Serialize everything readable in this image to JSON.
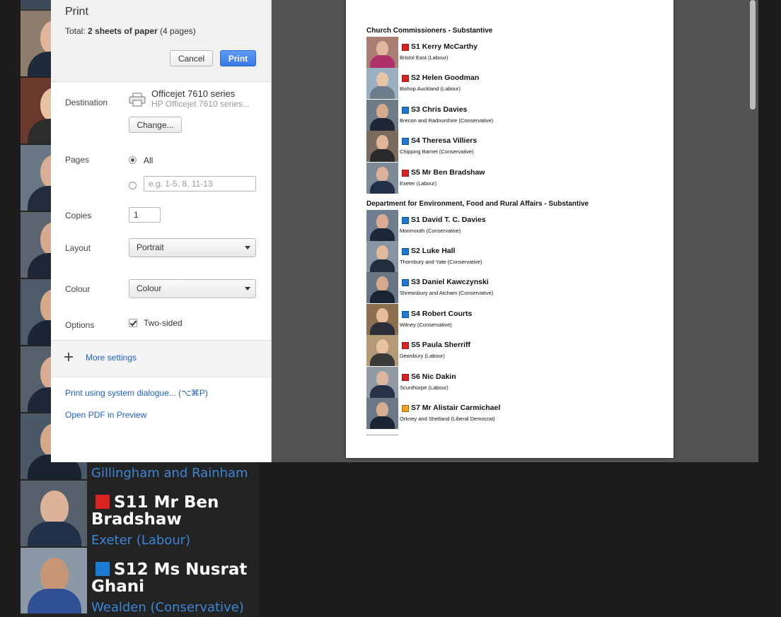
{
  "background": {
    "visible_cards": [
      {
        "constituency": "Gillingham and Rainham"
      },
      {
        "position": "S11",
        "name": "Mr Ben Bradshaw",
        "constituency": "Exeter (Labour)",
        "party_color": "#d92323"
      },
      {
        "position": "S12",
        "name": "Ms Nusrat Ghani",
        "constituency": "Wealden (Conservative)",
        "party_color": "#1a7ad4"
      }
    ]
  },
  "dialog": {
    "title": "Print",
    "total_prefix": "Total: ",
    "total_sheets": "2 sheets of paper",
    "total_pages": " (4 pages)",
    "cancel_label": "Cancel",
    "print_label": "Print",
    "destination": {
      "label": "Destination",
      "printer_name": "Officejet 7610 series",
      "printer_model": "HP Officejet 7610 series...",
      "change_label": "Change...",
      "icon": "printer-icon"
    },
    "pages": {
      "label": "Pages",
      "all_label": "All",
      "all_selected": true,
      "range_placeholder": "e.g. 1-5, 8, 11-13",
      "range_value": ""
    },
    "copies": {
      "label": "Copies",
      "value": "1"
    },
    "layout": {
      "label": "Layout",
      "value": "Portrait"
    },
    "colour": {
      "label": "Colour",
      "value": "Colour"
    },
    "options": {
      "label": "Options",
      "two_sided_label": "Two-sided",
      "two_sided_checked": true
    },
    "more_settings": "More settings",
    "system_dialog_link": "Print using system dialogue... (⌥⌘P)",
    "open_pdf_link": "Open PDF in Preview"
  },
  "preview": {
    "sections": [
      {
        "heading": "Church Commissioners - Substantive",
        "members": [
          {
            "position": "S1",
            "name": "Kerry McCarthy",
            "constituency": "Bristol East (Labour)",
            "party_color": "#d92323"
          },
          {
            "position": "S2",
            "name": "Helen Goodman",
            "constituency": "Bishop Auckland (Labour)",
            "party_color": "#d92323"
          },
          {
            "position": "S3",
            "name": "Chris Davies",
            "constituency": "Brecon and Radnorshire (Conservative)",
            "party_color": "#1a7ad4"
          },
          {
            "position": "S4",
            "name": "Theresa Villiers",
            "constituency": "Chipping Barnet (Conservative)",
            "party_color": "#1a7ad4"
          },
          {
            "position": "S5",
            "name": "Mr Ben Bradshaw",
            "constituency": "Exeter (Labour)",
            "party_color": "#d92323"
          }
        ]
      },
      {
        "heading": "Department for Environment, Food and Rural Affairs - Substantive",
        "members": [
          {
            "position": "S1",
            "name": "David T. C. Davies",
            "constituency": "Monmouth (Conservative)",
            "party_color": "#1a7ad4"
          },
          {
            "position": "S2",
            "name": "Luke Hall",
            "constituency": "Thornbury and Yate (Conservative)",
            "party_color": "#1a7ad4"
          },
          {
            "position": "S3",
            "name": "Daniel Kawczynski",
            "constituency": "Shrewsbury and Atcham (Conservative)",
            "party_color": "#1a7ad4"
          },
          {
            "position": "S4",
            "name": "Robert Courts",
            "constituency": "Witney (Conservative)",
            "party_color": "#1a7ad4"
          },
          {
            "position": "S5",
            "name": "Paula Sherriff",
            "constituency": "Dewsbury (Labour)",
            "party_color": "#d92323"
          },
          {
            "position": "S6",
            "name": "Nic Dakin",
            "constituency": "Scunthorpe (Labour)",
            "party_color": "#d92323"
          },
          {
            "position": "S7",
            "name": "Mr Alistair Carmichael",
            "constituency": "Orkney and Shetland (Liberal Democrat)",
            "party_color": "#f0a020"
          }
        ]
      }
    ]
  }
}
